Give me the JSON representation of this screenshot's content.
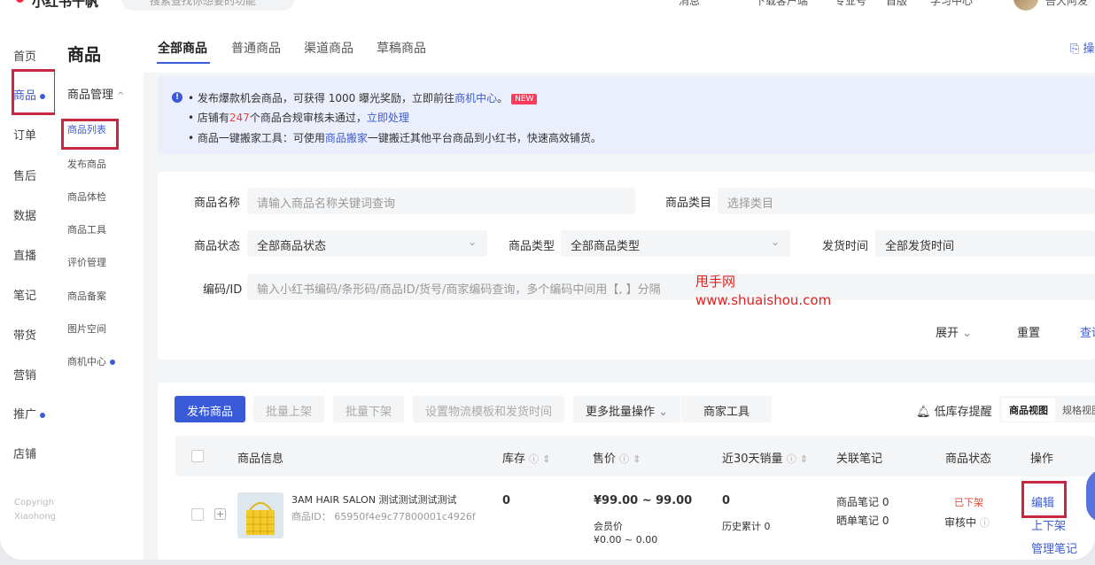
{
  "topbar": {
    "brand": "小红书千帆",
    "search_placeholder": "搜索查找你想要的功能",
    "items": [
      "消息",
      "下载客户端",
      "专业号",
      "首版",
      "学习中心"
    ],
    "user": "吾大阿发"
  },
  "nav1": {
    "items": [
      {
        "label": "首页",
        "active": false
      },
      {
        "label": "商品",
        "active": true,
        "dot": true
      },
      {
        "label": "订单",
        "active": false
      },
      {
        "label": "售后",
        "active": false
      },
      {
        "label": "数据",
        "active": false
      },
      {
        "label": "直播",
        "active": false
      },
      {
        "label": "笔记",
        "active": false
      },
      {
        "label": "带货",
        "active": false
      },
      {
        "label": "营销",
        "active": false
      },
      {
        "label": "推广",
        "active": false,
        "dot": true
      },
      {
        "label": "店铺",
        "active": false
      }
    ],
    "footer": [
      "Copyright",
      "Xiaohongshu"
    ]
  },
  "nav2": {
    "title": "商品",
    "group": "商品管理",
    "items": [
      {
        "label": "商品列表",
        "active": true
      },
      {
        "label": "发布商品"
      },
      {
        "label": "商品体检"
      },
      {
        "label": "商品工具"
      },
      {
        "label": "评价管理"
      },
      {
        "label": "商品备案"
      },
      {
        "label": "图片空间"
      },
      {
        "label": "商机中心",
        "dot": true
      }
    ]
  },
  "tabs": {
    "items": [
      "全部商品",
      "普通商品",
      "渠道商品",
      "草稿商品"
    ],
    "active": "全部商品",
    "right_action": "操"
  },
  "notice": {
    "line1_prefix": "• 发布爆款机会商品，可获得 1000 曝光奖励，立即前往",
    "line1_link": "商机中心",
    "line1_suffix": "。",
    "badge": "NEW",
    "line2_prefix": "• 店铺有",
    "line2_num": "247",
    "line2_mid": "个商品合规审核未通过，",
    "line2_link": "立即处理",
    "line3_prefix": "• 商品一键搬家工具：可使用",
    "line3_link": "商品搬家",
    "line3_suffix": "一键搬迁其他平台商品到小红书，快速高效铺货。"
  },
  "filters": {
    "name_label": "商品名称",
    "name_placeholder": "请输入商品名称关键词查询",
    "category_label": "商品类目",
    "category_placeholder": "选择类目",
    "status_label": "商品状态",
    "status_value": "全部商品状态",
    "type_label": "商品类型",
    "type_value": "全部商品类型",
    "ship_label": "发货时间",
    "ship_value": "全部发货时间",
    "code_label": "编码/ID",
    "code_placeholder": "输入小红书编码/条形码/商品ID/货号/商家编码查询，多个编码中间用【, 】分隔",
    "expand": "展开",
    "reset": "重置",
    "query": "查询"
  },
  "watermark": {
    "line1": "甩手网",
    "line2": "www.shuaishou.com"
  },
  "toolbar": {
    "publish": "发布商品",
    "batch_up": "批量上架",
    "batch_down": "批量下架",
    "logistics": "设置物流模板和发货时间",
    "more": "更多批量操作",
    "merchant_tools": "商家工具",
    "low_stock": "低库存提醒",
    "view_product": "商品视图",
    "view_spec": "规格视图"
  },
  "table": {
    "headers": {
      "info": "商品信息",
      "stock": "库存",
      "price": "售价",
      "sales30": "近30天销量",
      "notes": "关联笔记",
      "status": "商品状态",
      "ops": "操作"
    },
    "rows": [
      {
        "title": "3AM HAIR SALON 测试测试测试测试",
        "id_label": "商品ID：",
        "id": "65950f4e9c77800001c4926f",
        "stock": "0",
        "price": "¥99.00 ~ 99.00",
        "member_label": "会员价",
        "member_price": "¥0.00 ~ 0.00",
        "sales30": "0",
        "history": "历史累计 0",
        "note1": "商品笔记 0",
        "note2": "晒单笔记 0",
        "status": "已下架",
        "review": "审核中",
        "op_edit": "编辑",
        "op_up": "上下架",
        "op_notes": "管理笔记"
      }
    ]
  },
  "colors": {
    "accent": "#3a5bd9",
    "danger": "#e8463b",
    "annotation": "#c8283f"
  }
}
